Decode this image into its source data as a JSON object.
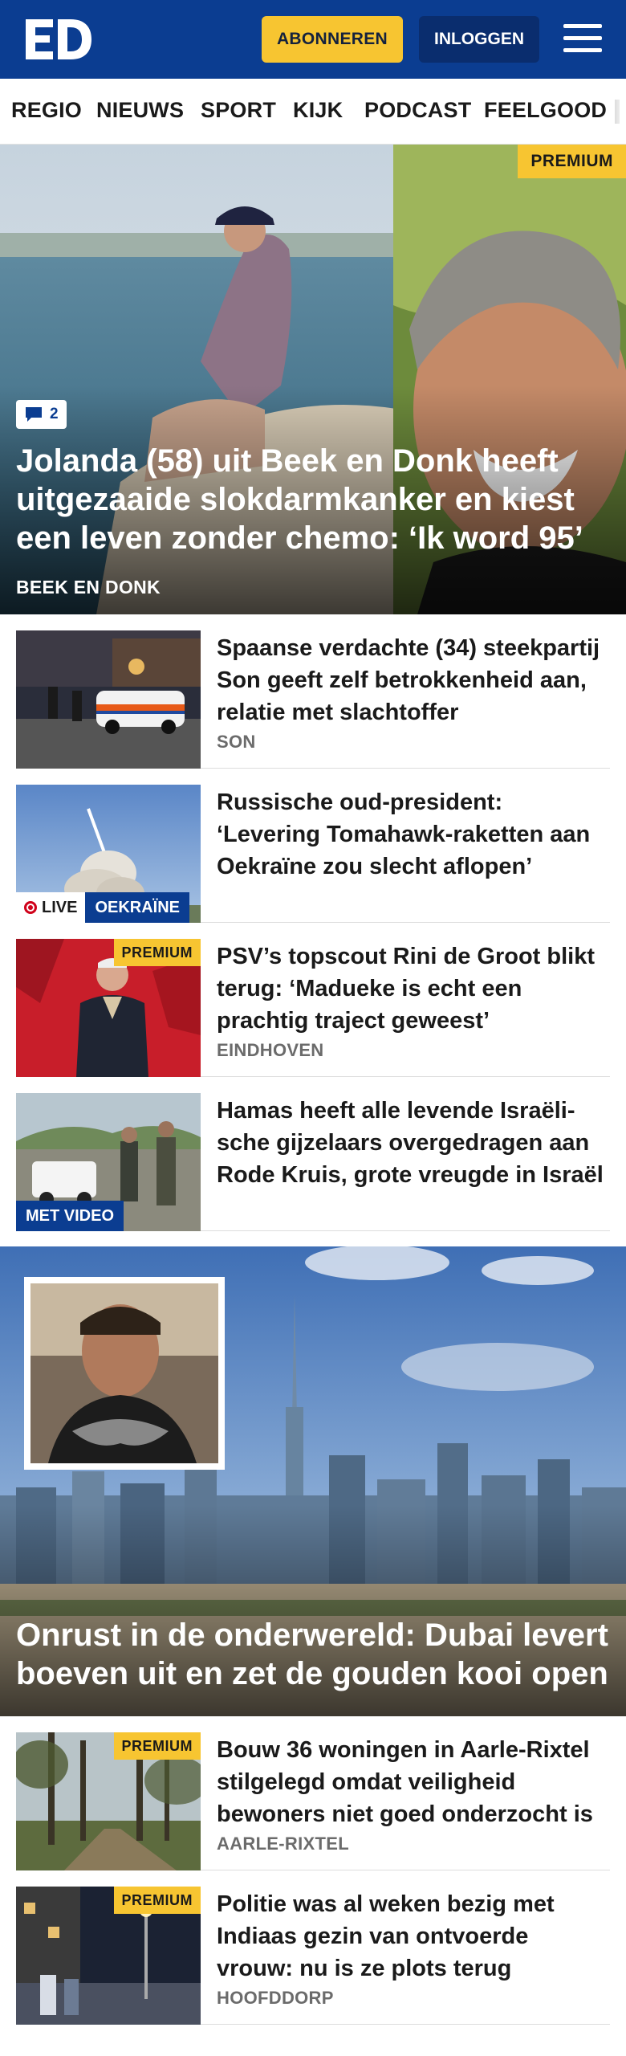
{
  "header": {
    "subscribe_label": "ABONNEREN",
    "login_label": "INLOGGEN",
    "brand_color": "#0b3d91",
    "accent_color": "#f7c531"
  },
  "nav": {
    "items": [
      "REGIO",
      "NIEUWS",
      "SPORT",
      "KIJK",
      "PODCAST",
      "FEELGOOD"
    ]
  },
  "hero": {
    "badge": "PREMIUM",
    "comment_count": "2",
    "title": "Jolanda (58) uit Beek en Donk heeft uitgezaaide slokdarmkanker en kiest een leven zonder chemo: ‘Ik word 95’",
    "location": "BEEK EN DONK"
  },
  "articles": [
    {
      "title": "Spaanse verdachte (34) steekpartij Son geeft zelf betrokkenheid aan, relatie met slachtoffer",
      "location": "SON"
    },
    {
      "title": "Russische oud-president: ‘Levering Tomahawk-raketten aan Oekraïne zou slecht aflopen’",
      "live_label": "LIVE",
      "topic": "OEKRAÏNE"
    },
    {
      "title": "PSV’s topscout Rini de Groot blikt terug: ‘Madueke is echt een prachtig traject geweest’",
      "location": "EINDHOVEN",
      "badge": "PREMIUM"
    },
    {
      "title": "Hamas heeft alle levende Israëli­sche gijzelaars overgedragen aan Rode Kruis, grote vreugde in Israël",
      "video_label": "MET VIDEO"
    }
  ],
  "hero2": {
    "title": "Onrust in de onderwereld: Dubai levert boeven uit en zet de gouden kooi open"
  },
  "articles2": [
    {
      "title": "Bouw 36 woningen in Aarle-Rix­tel stilgelegd omdat veiligheid bewoners niet goed onderzocht is",
      "location": "AARLE-RIXTEL",
      "badge": "PREMIUM"
    },
    {
      "title": "Politie was al weken bezig met Indiaas gezin van ontvoerde vrouw: nu is ze plots terug",
      "location": "HOOFDDORP",
      "badge": "PREMIUM"
    }
  ]
}
